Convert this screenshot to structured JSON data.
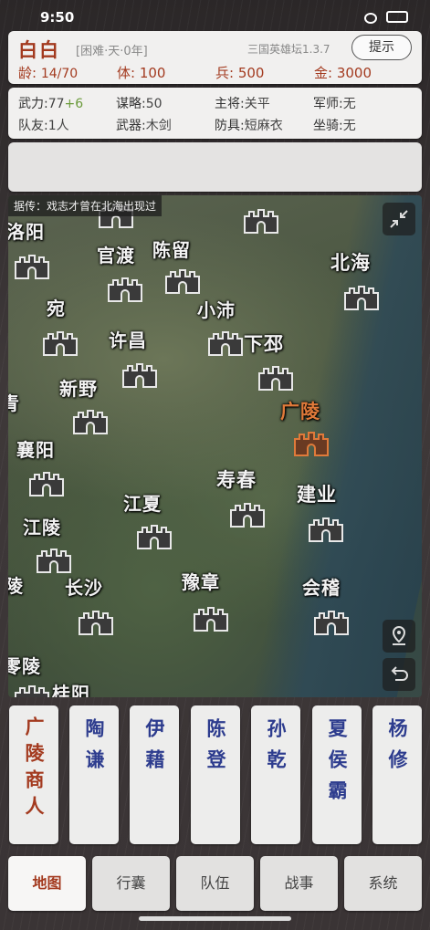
{
  "status_bar": {
    "time": "9:50"
  },
  "player": {
    "name": "白白",
    "difficulty": "[困难·天·0年]",
    "version": "三国英雄坛1.3.7",
    "hint_label": "提示",
    "age_label": "龄:",
    "age": "14/70",
    "stamina_label": "体:",
    "stamina": "100",
    "troops_label": "兵:",
    "troops": "500",
    "gold_label": "金:",
    "gold": "3000"
  },
  "attributes": {
    "force_label": "武力:",
    "force": "77",
    "force_bonus": "+6",
    "strategy_label": "谋略:",
    "strategy": "50",
    "general_label": "主将:",
    "general": "关平",
    "advisor_label": "军师:",
    "advisor": "无",
    "teammates_label": "队友:",
    "teammates": "1人",
    "weapon_label": "武器:",
    "weapon": "木剑",
    "armor_label": "防具:",
    "armor": "短麻衣",
    "mount_label": "坐骑:",
    "mount": "无"
  },
  "map": {
    "rumor": "据传：戏志才曾在北海出现过",
    "current_city": "广陵",
    "cities": {
      "luoyang": "洛阳",
      "guandu": "官渡",
      "chenliu": "陈留",
      "beihai": "北海",
      "wan": "宛",
      "xiaopei": "小沛",
      "xuchang": "许昌",
      "xiapi": "下邳",
      "xinye": "新野",
      "qing": "青",
      "guangling": "广陵",
      "xiangyang": "襄阳",
      "shouchun": "寿春",
      "jianye": "建业",
      "jiangxia": "江夏",
      "jiangling": "江陵",
      "ling": "陵",
      "changsha": "长沙",
      "yuzhang": "豫章",
      "kuaiji": "会稽",
      "lingling": "零陵",
      "guiyang": "桂阳"
    }
  },
  "characters": [
    {
      "name": "广陵商人",
      "selected": true
    },
    {
      "name": "陶谦",
      "selected": false
    },
    {
      "name": "伊藉",
      "selected": false
    },
    {
      "name": "陈登",
      "selected": false
    },
    {
      "name": "孙乾",
      "selected": false
    },
    {
      "name": "夏侯霸",
      "selected": false
    },
    {
      "name": "杨修",
      "selected": false
    }
  ],
  "tabs": [
    {
      "label": "地图",
      "selected": true
    },
    {
      "label": "行囊",
      "selected": false
    },
    {
      "label": "队伍",
      "selected": false
    },
    {
      "label": "战事",
      "selected": false
    },
    {
      "label": "系统",
      "selected": false
    }
  ],
  "colors": {
    "accent_red": "#a33a1f",
    "name_blue": "#2d3c8e",
    "active_city": "#e07a3a",
    "bonus_green": "#6a9a3a"
  }
}
